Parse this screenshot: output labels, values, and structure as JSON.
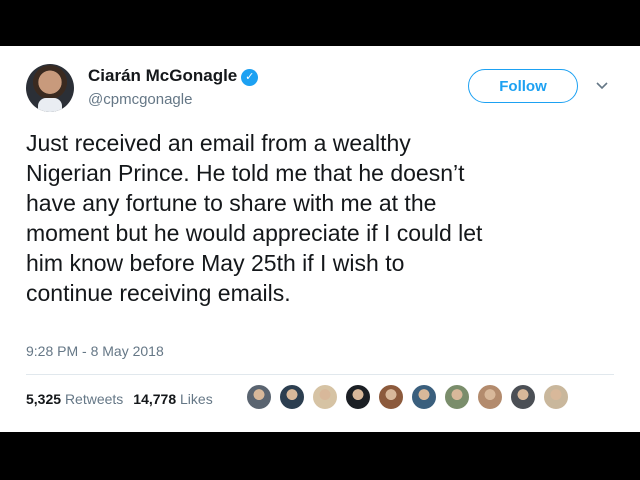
{
  "tweet": {
    "author_name": "Ciarán McGonagle",
    "verified_icon": "verified-badge-icon",
    "handle": "@cpmcgonagle",
    "follow_label": "Follow",
    "body_lines": [
      "Just received an email from a wealthy",
      "Nigerian Prince. He told me that he doesn’t",
      "have any fortune to share with me at the",
      "moment but he would appreciate if I could let",
      "him know before May 25th if I wish to",
      "continue receiving emails."
    ],
    "timestamp": "9:28 PM - 8 May 2018",
    "retweets_count": "5,325",
    "retweets_label": "Retweets",
    "likes_count": "14,778",
    "likes_label": "Likes"
  },
  "colors": {
    "accent": "#1da1f2",
    "text": "#14171a",
    "muted": "#657786",
    "background": "#ffffff",
    "frame": "#000000"
  },
  "liker_avatars": [
    "#5a6470",
    "#2c3e50",
    "#d6c3a4",
    "#1b1f24",
    "#8c5a3c",
    "#3a5f7d",
    "#7a8d6b",
    "#b38b6d",
    "#4b4f55",
    "#c9b79c"
  ]
}
